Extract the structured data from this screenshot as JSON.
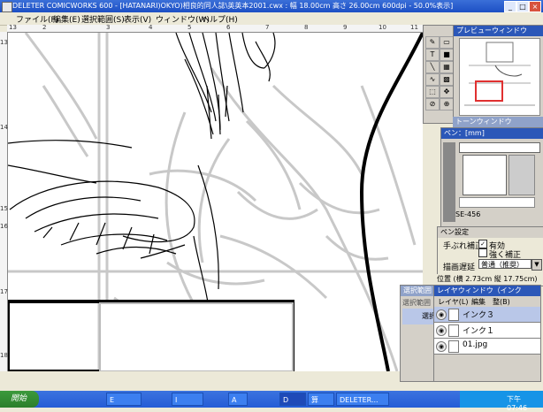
{
  "window": {
    "title": "DELETER COMICWORKS 600 - [HATANARI)OKYO)相良的同人誌\\英英本2001.cwx : 幅 18.00cm 高さ 26.00cm 600dpi - 50.0%表示]",
    "controls": [
      "_",
      "□",
      "×"
    ]
  },
  "menu": {
    "items": [
      "ファイル(F)",
      "編集(E)",
      "選択範囲(S)",
      "表示(V)",
      "ウィンドウ(W)",
      "ヘルプ(H)"
    ]
  },
  "rulers": {
    "top": [
      "13",
      "2",
      "3",
      "4",
      "5",
      "6",
      "7",
      "8",
      "9",
      "10",
      "11"
    ],
    "left": [
      "13",
      "14",
      "15",
      "16",
      "17",
      "18"
    ]
  },
  "tools": {
    "icons": [
      "pen-tool-icon",
      "eraser-tool-icon",
      "text-tool-icon",
      "fill-tool-icon",
      "line-tool-icon",
      "tone-tool-icon",
      "curve-tool-icon",
      "grid-tool-icon",
      "marquee-tool-icon",
      "move-tool-icon",
      "dropper-tool-icon",
      "zoom-tool-icon"
    ]
  },
  "preview": {
    "title": "プレビューウィンドウ"
  },
  "tone": {
    "title": "トーンウィンドウ"
  },
  "pen": {
    "title": "ペン：[mm]",
    "size_label": "SE-456"
  },
  "pen_settings": {
    "title": "ペン設定",
    "stabilizer_label": "手ぶれ補正",
    "enabled_label": "有効",
    "strong_label": "強く補正",
    "delay_label": "描画遅延",
    "delay_value": "普通（推奨）"
  },
  "status": {
    "position_text": "位置 (横 2.73cm 縦 17.75cm)"
  },
  "selection_window": {
    "title": "選択範囲",
    "tab": "選択範囲",
    "row_label": "選択"
  },
  "layer_window": {
    "title": "レイヤウィンドウ（インク",
    "menu": [
      "レイヤ(L)",
      "編集",
      "整(B)"
    ],
    "layers": [
      {
        "name": "インク３",
        "active": true
      },
      {
        "name": "インク１",
        "active": false
      },
      {
        "name": "01.jpg",
        "active": false
      }
    ]
  },
  "taskbar": {
    "start_label": "開始",
    "buttons": [
      "E",
      "I",
      "A",
      "D",
      "算",
      "DELETER..."
    ],
    "clock": "下午 07:46"
  }
}
